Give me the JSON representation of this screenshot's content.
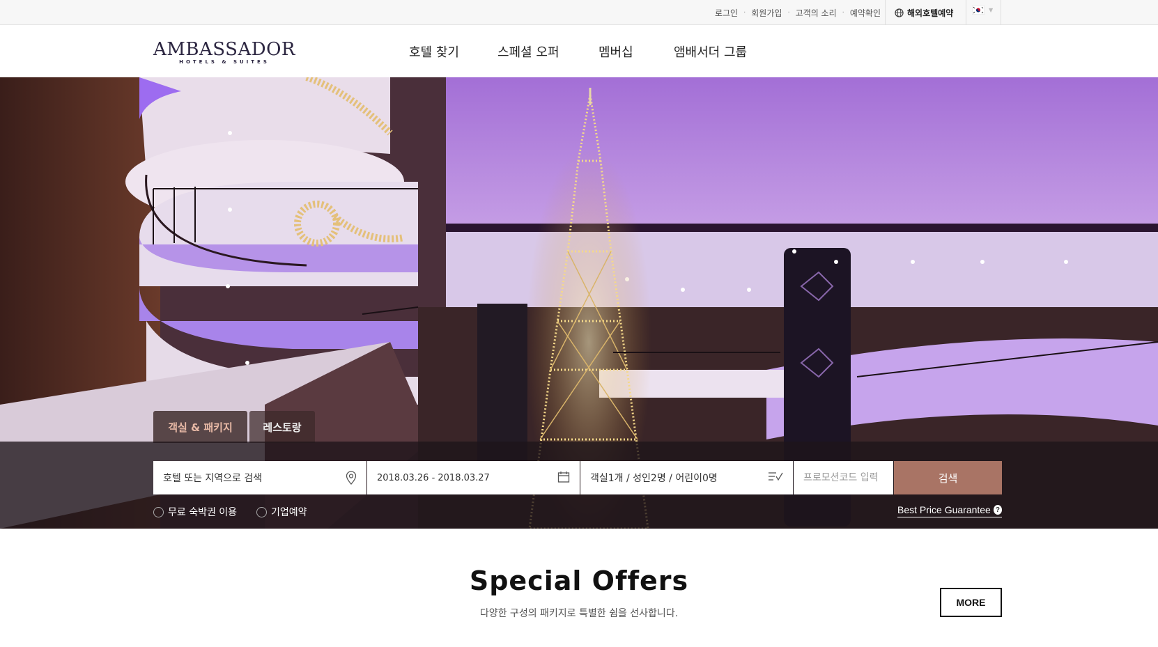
{
  "util": {
    "links": [
      "로그인",
      "회원가입",
      "고객의 소리",
      "예약확인"
    ],
    "overseas": "해외호텔예약"
  },
  "logo": {
    "text": "AMBASSADOR",
    "sub": "HOTELS & SUITES"
  },
  "nav": [
    "호텔 찾기",
    "스페셜 오퍼",
    "멤버십",
    "앰배서더 그룹"
  ],
  "tabs": {
    "rooms": "객실 & 패키지",
    "restaurant": "레스토랑"
  },
  "search": {
    "hotel_placeholder": "호텔 또는 지역으로 검색",
    "dates": "2018.03.26 - 2018.03.27",
    "rooms": "객실1개 / 성인2명 / 어린이0명",
    "promo_placeholder": "프로모션코드 입력",
    "button": "검색"
  },
  "options": {
    "free_stay": "무료 숙박권 이용",
    "corporate": "기업예약"
  },
  "bpg": "Best Price Guarantee",
  "offers": {
    "title": "Special Offers",
    "subtitle": "다양한 구성의 패키지로 특별한 쉼을 선사합니다.",
    "more": "MORE"
  },
  "colors": {
    "accent": "#a97465",
    "tab_active_text": "#e8b9a6"
  },
  "icons": [
    "globe-icon",
    "korea-flag-icon",
    "location-pin-icon",
    "calendar-icon",
    "room-select-icon",
    "help-icon"
  ]
}
